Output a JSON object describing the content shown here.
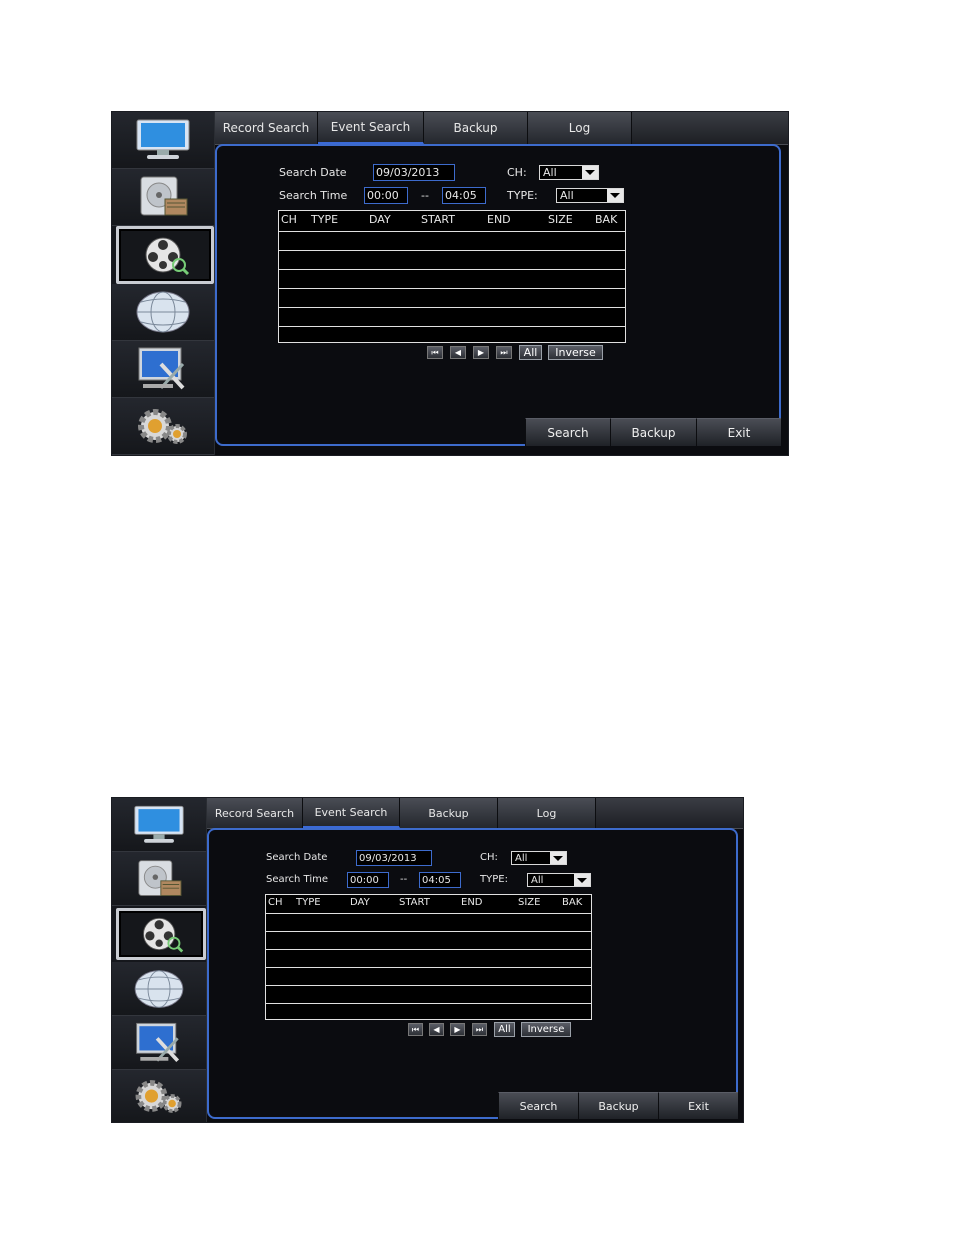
{
  "tabs": [
    {
      "label": "Record Search"
    },
    {
      "label": "Event Search",
      "active": true
    },
    {
      "label": "Backup"
    },
    {
      "label": "Log"
    }
  ],
  "sidebar": [
    {
      "icon": "monitor-icon"
    },
    {
      "icon": "hard-disk-icon"
    },
    {
      "icon": "film-reel-search-icon",
      "active": true
    },
    {
      "icon": "network-globe-icon"
    },
    {
      "icon": "system-tools-icon"
    },
    {
      "icon": "settings-gears-icon"
    }
  ],
  "form": {
    "search_date_label": "Search Date",
    "search_date_value": "09/03/2013",
    "ch_label": "CH:",
    "ch_value": "All",
    "search_time_label": "Search Time",
    "time_start": "00:00",
    "time_sep": "--",
    "time_end": "04:05",
    "type_label": "TYPE:",
    "type_value": "All"
  },
  "table": {
    "headers": [
      "CH",
      "TYPE",
      "DAY",
      "START",
      "END",
      "SIZE",
      "BAK"
    ]
  },
  "pager": {
    "first": "⏮",
    "prev": "◀",
    "next": "▶",
    "last": "⏭",
    "all_label": "All",
    "inverse_label": "Inverse"
  },
  "actions": {
    "search_label": "Search",
    "backup_label": "Backup",
    "exit_label": "Exit"
  },
  "colors": {
    "accent": "#3d6bcc",
    "background": "#0b0c10",
    "text": "#e8e8e8"
  }
}
